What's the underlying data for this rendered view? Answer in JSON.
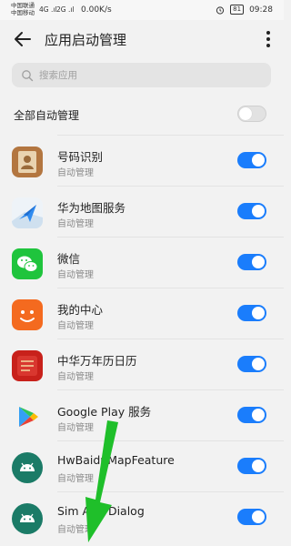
{
  "status_bar": {
    "carrier_line1": "中国联通",
    "carrier_line2": "中国移动",
    "signal1": "4G .ıl",
    "signal2": "2G .ıl",
    "net_speed": "0.00K/s",
    "battery": "81",
    "time": "09:28"
  },
  "header": {
    "title": "应用启动管理"
  },
  "search": {
    "placeholder": "搜索应用"
  },
  "all_auto": {
    "label": "全部自动管理",
    "enabled": false
  },
  "apps": [
    {
      "name": "号码识别",
      "status": "自动管理",
      "enabled": true,
      "icon": "contacts-icon"
    },
    {
      "name": "华为地图服务",
      "status": "自动管理",
      "enabled": true,
      "icon": "map-icon"
    },
    {
      "name": "微信",
      "status": "自动管理",
      "enabled": true,
      "icon": "wechat-icon"
    },
    {
      "name": "我的中心",
      "status": "自动管理",
      "enabled": true,
      "icon": "my-center-icon"
    },
    {
      "name": "中华万年历日历",
      "status": "自动管理",
      "enabled": true,
      "icon": "calendar-icon"
    },
    {
      "name": "Google Play 服务",
      "status": "自动管理",
      "enabled": true,
      "icon": "google-play-icon"
    },
    {
      "name": "HwBaiduMapFeature",
      "status": "自动管理",
      "enabled": true,
      "icon": "android-icon"
    },
    {
      "name": "Sim App Dialog",
      "status": "自动管理",
      "enabled": true,
      "icon": "android-icon"
    }
  ],
  "colors": {
    "accent": "#1a7dfc",
    "arrow": "#1fbf2a"
  }
}
